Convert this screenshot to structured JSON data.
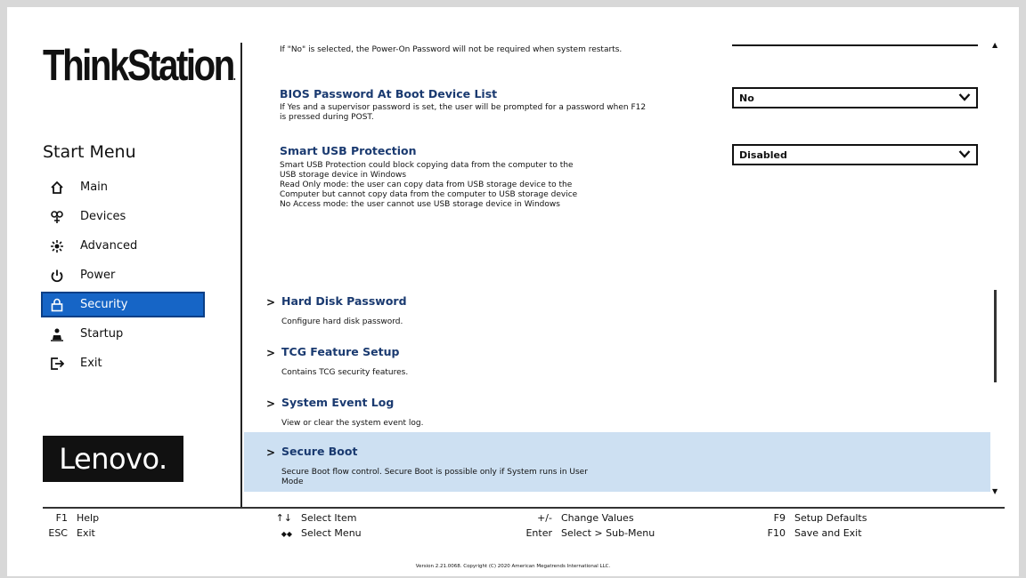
{
  "brand": {
    "product": "ThinkStation",
    "vendor": "Lenovo."
  },
  "sidebar": {
    "title": "Start Menu",
    "items": [
      {
        "label": "Main",
        "icon": "home-icon"
      },
      {
        "label": "Devices",
        "icon": "devices-icon"
      },
      {
        "label": "Advanced",
        "icon": "advanced-icon"
      },
      {
        "label": "Power",
        "icon": "power-icon"
      },
      {
        "label": "Security",
        "icon": "lock-icon",
        "active": true
      },
      {
        "label": "Startup",
        "icon": "startup-icon"
      },
      {
        "label": "Exit",
        "icon": "exit-icon"
      }
    ]
  },
  "settings": {
    "power_on_desc": "If \"No\" is selected, the Power-On Password will not be required when system restarts.",
    "boot_device_list": {
      "title": "BIOS Password At Boot Device List",
      "desc": "If Yes and a supervisor password is set, the user will be prompted for a password when F12 is pressed during POST.",
      "value": "No"
    },
    "smart_usb": {
      "title": "Smart USB Protection",
      "desc_lines": [
        "Smart USB Protection could block copying data from the computer to the",
        "USB storage device in Windows",
        "Read Only mode: the user can copy data from USB storage device to the",
        "Computer but cannot copy data from the computer to USB storage device",
        "No Access mode: the user cannot use USB storage device in Windows"
      ],
      "value": "Disabled"
    }
  },
  "submenus": [
    {
      "title": "Hard Disk Password",
      "desc": "Configure hard disk password."
    },
    {
      "title": "TCG Feature Setup",
      "desc": "Contains TCG security features."
    },
    {
      "title": "System Event Log",
      "desc": "View or clear the system event log."
    },
    {
      "title": "Secure Boot",
      "desc_lines": [
        "Secure Boot flow control. Secure Boot is possible only if System runs in User",
        "Mode"
      ],
      "highlighted": true
    }
  ],
  "arrow_glyph": ">",
  "footer": {
    "col1": [
      {
        "key": "F1",
        "label": "Help"
      },
      {
        "key": "ESC",
        "label": "Exit"
      }
    ],
    "col2": [
      {
        "key": "↑↓",
        "label": "Select Item"
      },
      {
        "key": "◆◆",
        "label": "Select Menu"
      }
    ],
    "col3": [
      {
        "key": "+/-",
        "label": "Change Values"
      },
      {
        "key": "Enter",
        "label": "Select > Sub-Menu"
      }
    ],
    "col4": [
      {
        "key": "F9",
        "label": "Setup Defaults"
      },
      {
        "key": "F10",
        "label": "Save and Exit"
      }
    ]
  },
  "copyright": "Version 2.21.0068. Copyright (C) 2020 American Megatrends International LLC.",
  "colors": {
    "active_nav": "#1665c6",
    "highlight_row": "#cde0f2",
    "heading": "#1a3a70"
  }
}
